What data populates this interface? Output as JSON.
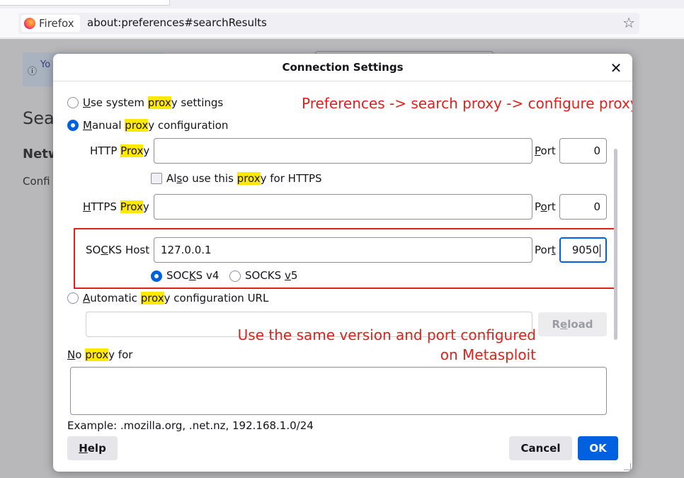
{
  "browser": {
    "identity_label": "Firefox",
    "url": "about:preferences#searchResults",
    "star_icon": "star-icon"
  },
  "background_page": {
    "notice_text": "Yo org",
    "heading": "Sea",
    "section_heading": "Netw",
    "section_text": "Confi"
  },
  "dialog": {
    "title": "Connection Settings",
    "close_glyph": "✕",
    "options": {
      "system_proxy": {
        "pre": "U",
        "ul": "",
        "mid": "se system ",
        "hl": "prox",
        "post": "y settings",
        "checked": false
      },
      "manual_proxy": {
        "pre": "",
        "ul": "M",
        "mid": "anual ",
        "hl": "prox",
        "post": "y configuration",
        "checked": true
      },
      "auto_proxy": {
        "pre": "",
        "ul": "A",
        "mid": "utomatic ",
        "hl": "prox",
        "post": "y configuration URL",
        "checked": false
      }
    },
    "http": {
      "label_pre": "HTTP ",
      "label_hl": "Prox",
      "label_post": "y",
      "value": "",
      "port_label_ul": "P",
      "port_label_rest": "ort",
      "port": "0"
    },
    "also_https": {
      "pre": "Al",
      "ul": "s",
      "mid": "o use this ",
      "hl": "prox",
      "post": "y for HTTPS",
      "checked": false
    },
    "https": {
      "label_ul": "H",
      "label_pre": "TTPS ",
      "label_hl": "Prox",
      "label_post": "y",
      "value": "",
      "port_label_pre": "P",
      "port_label_ul": "o",
      "port_label_rest": "rt",
      "port": "0"
    },
    "socks": {
      "label_pre": "SO",
      "label_ul": "C",
      "label_post": "KS Host",
      "value": "127.0.0.1",
      "port_label_pre": "Por",
      "port_label_ul": "t",
      "port": "9050",
      "v4": {
        "pre": "SOC",
        "ul": "K",
        "post": "S v4",
        "checked": true
      },
      "v5": {
        "pre": "SOCKS ",
        "ul": "v",
        "post": "5",
        "checked": false
      }
    },
    "auto_url_value": "",
    "reload": {
      "pre": "R",
      "ul": "e",
      "post": "load"
    },
    "no_proxy": {
      "ul": "N",
      "pre": "o ",
      "hl": "prox",
      "post": "y for",
      "value": ""
    },
    "example": "Example: .mozilla.org, .net.nz, 192.168.1.0/24",
    "help": {
      "ul": "H",
      "post": "elp"
    },
    "cancel_label": "Cancel",
    "ok_label": "OK"
  },
  "annotations": {
    "top": "Preferences -> search proxy -> configure proxy",
    "middle_line1": "Use the same version and port configured",
    "middle_line2": "on Metasploit",
    "color": "#e0211b"
  },
  "colors": {
    "accent": "#0061e0",
    "highlight": "#ffe900"
  }
}
